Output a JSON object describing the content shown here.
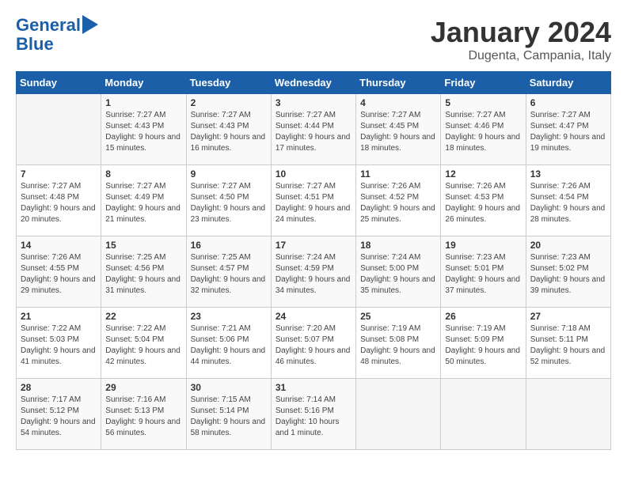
{
  "header": {
    "logo_line1": "General",
    "logo_line2": "Blue",
    "month": "January 2024",
    "location": "Dugenta, Campania, Italy"
  },
  "days_of_week": [
    "Sunday",
    "Monday",
    "Tuesday",
    "Wednesday",
    "Thursday",
    "Friday",
    "Saturday"
  ],
  "weeks": [
    [
      {
        "day": "",
        "sunrise": "",
        "sunset": "",
        "daylight": ""
      },
      {
        "day": "1",
        "sunrise": "Sunrise: 7:27 AM",
        "sunset": "Sunset: 4:43 PM",
        "daylight": "Daylight: 9 hours and 15 minutes."
      },
      {
        "day": "2",
        "sunrise": "Sunrise: 7:27 AM",
        "sunset": "Sunset: 4:43 PM",
        "daylight": "Daylight: 9 hours and 16 minutes."
      },
      {
        "day": "3",
        "sunrise": "Sunrise: 7:27 AM",
        "sunset": "Sunset: 4:44 PM",
        "daylight": "Daylight: 9 hours and 17 minutes."
      },
      {
        "day": "4",
        "sunrise": "Sunrise: 7:27 AM",
        "sunset": "Sunset: 4:45 PM",
        "daylight": "Daylight: 9 hours and 18 minutes."
      },
      {
        "day": "5",
        "sunrise": "Sunrise: 7:27 AM",
        "sunset": "Sunset: 4:46 PM",
        "daylight": "Daylight: 9 hours and 18 minutes."
      },
      {
        "day": "6",
        "sunrise": "Sunrise: 7:27 AM",
        "sunset": "Sunset: 4:47 PM",
        "daylight": "Daylight: 9 hours and 19 minutes."
      }
    ],
    [
      {
        "day": "7",
        "sunrise": "Sunrise: 7:27 AM",
        "sunset": "Sunset: 4:48 PM",
        "daylight": "Daylight: 9 hours and 20 minutes."
      },
      {
        "day": "8",
        "sunrise": "Sunrise: 7:27 AM",
        "sunset": "Sunset: 4:49 PM",
        "daylight": "Daylight: 9 hours and 21 minutes."
      },
      {
        "day": "9",
        "sunrise": "Sunrise: 7:27 AM",
        "sunset": "Sunset: 4:50 PM",
        "daylight": "Daylight: 9 hours and 23 minutes."
      },
      {
        "day": "10",
        "sunrise": "Sunrise: 7:27 AM",
        "sunset": "Sunset: 4:51 PM",
        "daylight": "Daylight: 9 hours and 24 minutes."
      },
      {
        "day": "11",
        "sunrise": "Sunrise: 7:26 AM",
        "sunset": "Sunset: 4:52 PM",
        "daylight": "Daylight: 9 hours and 25 minutes."
      },
      {
        "day": "12",
        "sunrise": "Sunrise: 7:26 AM",
        "sunset": "Sunset: 4:53 PM",
        "daylight": "Daylight: 9 hours and 26 minutes."
      },
      {
        "day": "13",
        "sunrise": "Sunrise: 7:26 AM",
        "sunset": "Sunset: 4:54 PM",
        "daylight": "Daylight: 9 hours and 28 minutes."
      }
    ],
    [
      {
        "day": "14",
        "sunrise": "Sunrise: 7:26 AM",
        "sunset": "Sunset: 4:55 PM",
        "daylight": "Daylight: 9 hours and 29 minutes."
      },
      {
        "day": "15",
        "sunrise": "Sunrise: 7:25 AM",
        "sunset": "Sunset: 4:56 PM",
        "daylight": "Daylight: 9 hours and 31 minutes."
      },
      {
        "day": "16",
        "sunrise": "Sunrise: 7:25 AM",
        "sunset": "Sunset: 4:57 PM",
        "daylight": "Daylight: 9 hours and 32 minutes."
      },
      {
        "day": "17",
        "sunrise": "Sunrise: 7:24 AM",
        "sunset": "Sunset: 4:59 PM",
        "daylight": "Daylight: 9 hours and 34 minutes."
      },
      {
        "day": "18",
        "sunrise": "Sunrise: 7:24 AM",
        "sunset": "Sunset: 5:00 PM",
        "daylight": "Daylight: 9 hours and 35 minutes."
      },
      {
        "day": "19",
        "sunrise": "Sunrise: 7:23 AM",
        "sunset": "Sunset: 5:01 PM",
        "daylight": "Daylight: 9 hours and 37 minutes."
      },
      {
        "day": "20",
        "sunrise": "Sunrise: 7:23 AM",
        "sunset": "Sunset: 5:02 PM",
        "daylight": "Daylight: 9 hours and 39 minutes."
      }
    ],
    [
      {
        "day": "21",
        "sunrise": "Sunrise: 7:22 AM",
        "sunset": "Sunset: 5:03 PM",
        "daylight": "Daylight: 9 hours and 41 minutes."
      },
      {
        "day": "22",
        "sunrise": "Sunrise: 7:22 AM",
        "sunset": "Sunset: 5:04 PM",
        "daylight": "Daylight: 9 hours and 42 minutes."
      },
      {
        "day": "23",
        "sunrise": "Sunrise: 7:21 AM",
        "sunset": "Sunset: 5:06 PM",
        "daylight": "Daylight: 9 hours and 44 minutes."
      },
      {
        "day": "24",
        "sunrise": "Sunrise: 7:20 AM",
        "sunset": "Sunset: 5:07 PM",
        "daylight": "Daylight: 9 hours and 46 minutes."
      },
      {
        "day": "25",
        "sunrise": "Sunrise: 7:19 AM",
        "sunset": "Sunset: 5:08 PM",
        "daylight": "Daylight: 9 hours and 48 minutes."
      },
      {
        "day": "26",
        "sunrise": "Sunrise: 7:19 AM",
        "sunset": "Sunset: 5:09 PM",
        "daylight": "Daylight: 9 hours and 50 minutes."
      },
      {
        "day": "27",
        "sunrise": "Sunrise: 7:18 AM",
        "sunset": "Sunset: 5:11 PM",
        "daylight": "Daylight: 9 hours and 52 minutes."
      }
    ],
    [
      {
        "day": "28",
        "sunrise": "Sunrise: 7:17 AM",
        "sunset": "Sunset: 5:12 PM",
        "daylight": "Daylight: 9 hours and 54 minutes."
      },
      {
        "day": "29",
        "sunrise": "Sunrise: 7:16 AM",
        "sunset": "Sunset: 5:13 PM",
        "daylight": "Daylight: 9 hours and 56 minutes."
      },
      {
        "day": "30",
        "sunrise": "Sunrise: 7:15 AM",
        "sunset": "Sunset: 5:14 PM",
        "daylight": "Daylight: 9 hours and 58 minutes."
      },
      {
        "day": "31",
        "sunrise": "Sunrise: 7:14 AM",
        "sunset": "Sunset: 5:16 PM",
        "daylight": "Daylight: 10 hours and 1 minute."
      },
      {
        "day": "",
        "sunrise": "",
        "sunset": "",
        "daylight": ""
      },
      {
        "day": "",
        "sunrise": "",
        "sunset": "",
        "daylight": ""
      },
      {
        "day": "",
        "sunrise": "",
        "sunset": "",
        "daylight": ""
      }
    ]
  ]
}
